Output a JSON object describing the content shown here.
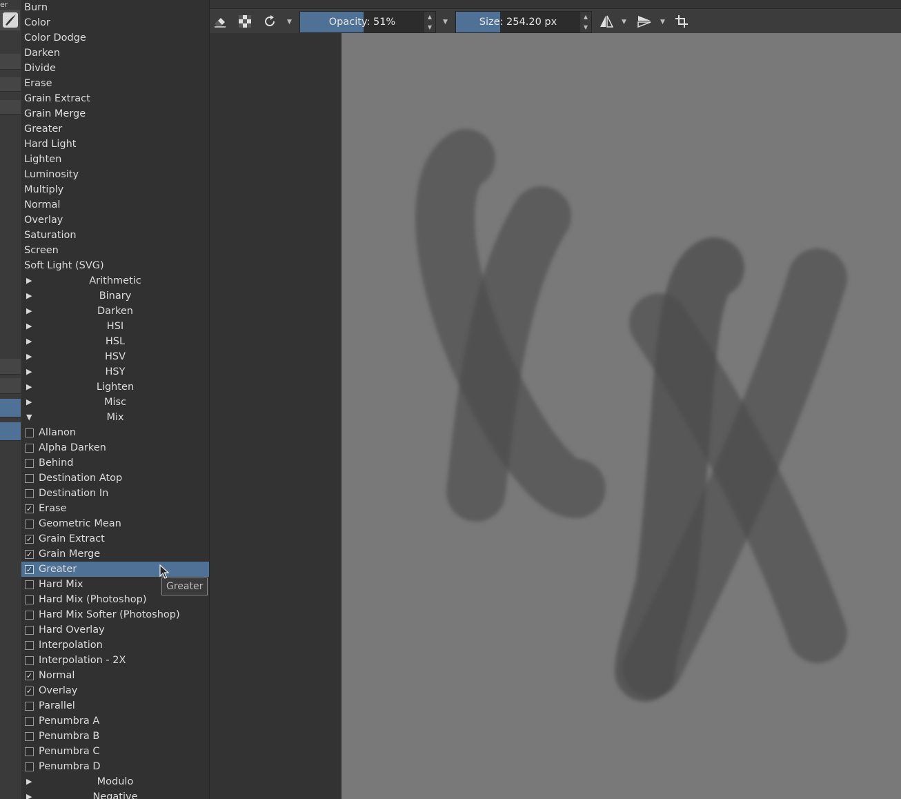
{
  "menu_fragment": "er",
  "blend_modes_flat": [
    "Burn",
    "Color",
    "Color Dodge",
    "Darken",
    "Divide",
    "Erase",
    "Grain Extract",
    "Grain Merge",
    "Greater",
    "Hard Light",
    "Lighten",
    "Luminosity",
    "Multiply",
    "Normal",
    "Overlay",
    "Saturation",
    "Screen",
    "Soft Light (SVG)"
  ],
  "groups": [
    {
      "label": "Arithmetic",
      "expanded": false
    },
    {
      "label": "Binary",
      "expanded": false
    },
    {
      "label": "Darken",
      "expanded": false
    },
    {
      "label": "HSI",
      "expanded": false
    },
    {
      "label": "HSL",
      "expanded": false
    },
    {
      "label": "HSV",
      "expanded": false
    },
    {
      "label": "HSY",
      "expanded": false
    },
    {
      "label": "Lighten",
      "expanded": false
    },
    {
      "label": "Misc",
      "expanded": false
    },
    {
      "label": "Mix",
      "expanded": true
    }
  ],
  "mix_items": [
    {
      "label": "Allanon",
      "checked": false
    },
    {
      "label": "Alpha Darken",
      "checked": false
    },
    {
      "label": "Behind",
      "checked": false
    },
    {
      "label": "Destination Atop",
      "checked": false
    },
    {
      "label": "Destination In",
      "checked": false
    },
    {
      "label": "Erase",
      "checked": true
    },
    {
      "label": "Geometric Mean",
      "checked": false
    },
    {
      "label": "Grain Extract",
      "checked": true
    },
    {
      "label": "Grain Merge",
      "checked": true
    },
    {
      "label": "Greater",
      "checked": true,
      "selected": true
    },
    {
      "label": "Hard Mix",
      "checked": false
    },
    {
      "label": "Hard Mix (Photoshop)",
      "checked": false
    },
    {
      "label": "Hard Mix Softer (Photoshop)",
      "checked": false
    },
    {
      "label": "Hard Overlay",
      "checked": false
    },
    {
      "label": "Interpolation",
      "checked": false
    },
    {
      "label": "Interpolation - 2X",
      "checked": false
    },
    {
      "label": "Normal",
      "checked": true
    },
    {
      "label": "Overlay",
      "checked": true
    },
    {
      "label": "Parallel",
      "checked": false
    },
    {
      "label": "Penumbra A",
      "checked": false
    },
    {
      "label": "Penumbra B",
      "checked": false
    },
    {
      "label": "Penumbra C",
      "checked": false
    },
    {
      "label": "Penumbra D",
      "checked": false
    }
  ],
  "trailing_groups": [
    {
      "label": "Modulo",
      "expanded": false
    },
    {
      "label": "Negative",
      "expanded": false
    }
  ],
  "tooltip": "Greater",
  "toolbar": {
    "opacity_label": "Opacity: 51%",
    "opacity_value": 0.51,
    "size_label": "Size: 254.20 px",
    "size_value": 254.2,
    "icons": [
      "eraser-icon",
      "alpha-lock-icon",
      "reload-preset-icon",
      "mirror-horizontal-icon",
      "mirror-vertical-icon",
      "wrap-around-icon"
    ]
  },
  "colors": {
    "accent": "#4f7196",
    "canvas": "#797979",
    "panel": "#313131"
  }
}
